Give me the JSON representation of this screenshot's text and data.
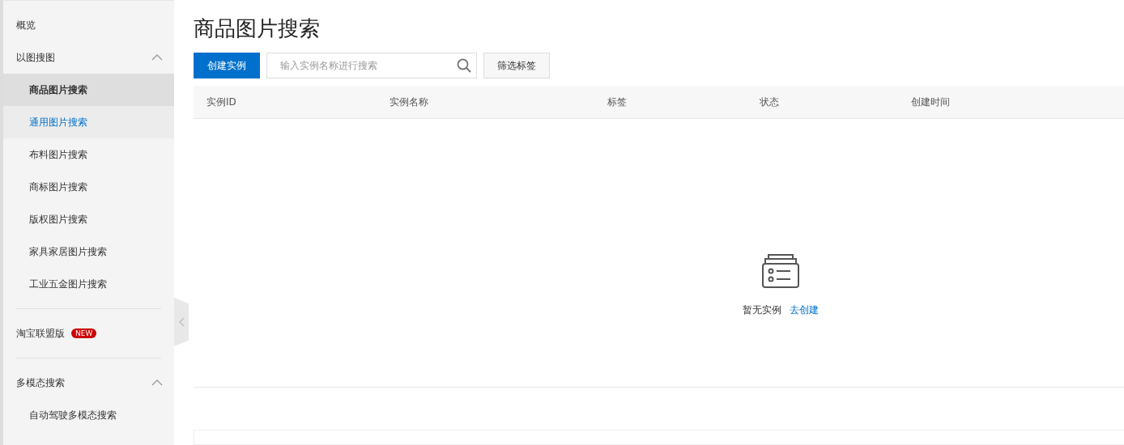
{
  "sidebar": {
    "items": [
      {
        "label": "概览",
        "kind": "top"
      },
      {
        "label": "以图搜图",
        "kind": "group",
        "expanded": true,
        "children": [
          {
            "label": "商品图片搜索",
            "selected": true,
            "hovered": false
          },
          {
            "label": "通用图片搜索",
            "selected": false,
            "hovered": true
          },
          {
            "label": "布料图片搜索",
            "selected": false,
            "hovered": false
          },
          {
            "label": "商标图片搜索",
            "selected": false,
            "hovered": false
          },
          {
            "label": "版权图片搜索",
            "selected": false,
            "hovered": false
          },
          {
            "label": "家具家居图片搜索",
            "selected": false,
            "hovered": false
          },
          {
            "label": "工业五金图片搜索",
            "selected": false,
            "hovered": false
          }
        ]
      },
      {
        "kind": "divider"
      },
      {
        "label": "淘宝联盟版",
        "kind": "top",
        "badge": "NEW"
      },
      {
        "kind": "divider"
      },
      {
        "label": "多模态搜索",
        "kind": "group",
        "expanded": true,
        "children": [
          {
            "label": "自动驾驶多模态搜索",
            "selected": false,
            "hovered": false
          }
        ]
      }
    ]
  },
  "page": {
    "title": "商品图片搜索",
    "create_button": "创建实例",
    "search": {
      "placeholder": "输入实例名称进行搜索"
    },
    "filter_button": "筛选标签"
  },
  "table": {
    "columns": [
      "实例ID",
      "实例名称",
      "标签",
      "状态",
      "创建时间"
    ],
    "empty": {
      "message": "暂无实例",
      "link": "去创建"
    }
  }
}
